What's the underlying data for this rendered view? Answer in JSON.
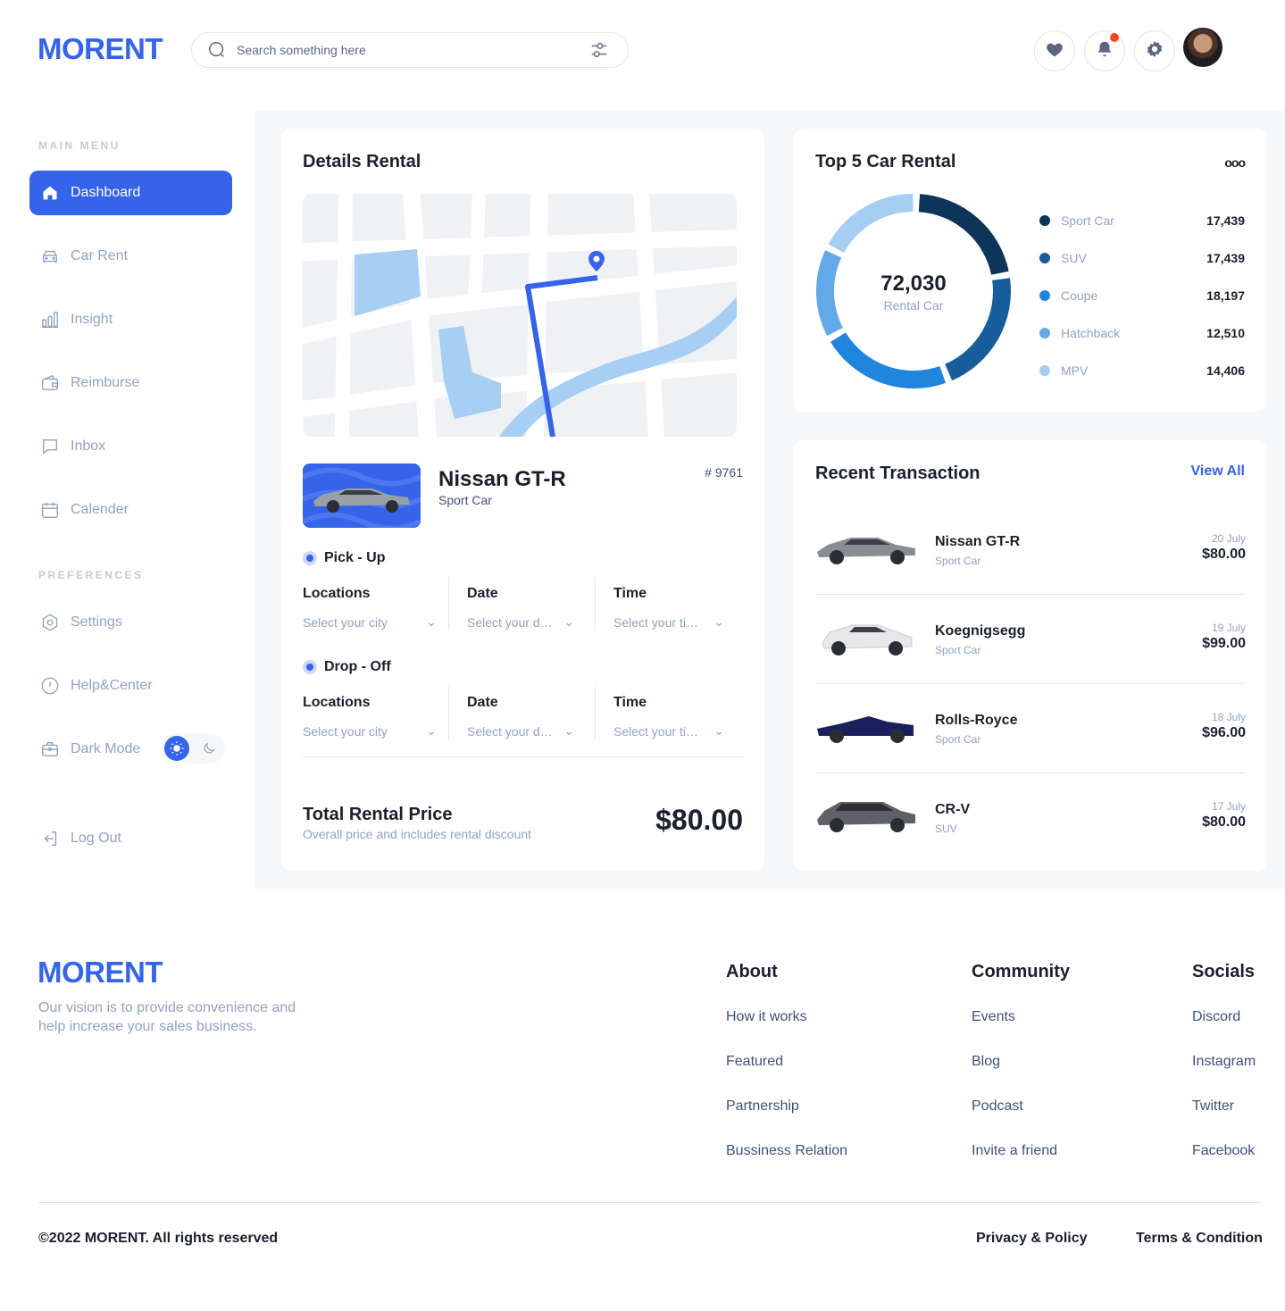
{
  "brand": {
    "name": "MORENT",
    "accent": "#3563e9"
  },
  "search": {
    "placeholder": "Search something here"
  },
  "sidebar": {
    "main_menu_heading": "MAIN MENU",
    "preferences_heading": "PREFERENCES",
    "items": [
      {
        "label": "Dashboard",
        "icon": "home-icon",
        "active": true
      },
      {
        "label": "Car Rent",
        "icon": "car-icon"
      },
      {
        "label": "Insight",
        "icon": "chart-icon"
      },
      {
        "label": "Reimburse",
        "icon": "wallet-icon"
      },
      {
        "label": "Inbox",
        "icon": "message-icon"
      },
      {
        "label": "Calender",
        "icon": "calendar-icon"
      }
    ],
    "preferences": [
      {
        "label": "Settings",
        "icon": "settings-icon"
      },
      {
        "label": "Help&Center",
        "icon": "info-icon"
      },
      {
        "label": "Dark Mode",
        "icon": "briefcase-icon"
      }
    ],
    "logout_label": "Log Out"
  },
  "details": {
    "title": "Details Rental",
    "car_name": "Nissan GT-R",
    "car_type": "Sport Car",
    "car_id": "# 9761",
    "pickup": {
      "heading": "Pick - Up",
      "location_label": "Locations",
      "location_value": "Select your city",
      "date_label": "Date",
      "date_value": "Select your date",
      "time_label": "Time",
      "time_value": "Select your time"
    },
    "dropoff": {
      "heading": "Drop - Off",
      "location_label": "Locations",
      "location_value": "Select your city",
      "date_label": "Date",
      "date_value": "Select your date",
      "time_label": "Time",
      "time_value": "Select your time"
    },
    "total_title": "Total Rental Price",
    "total_sub": "Overall price and includes rental discount",
    "total_price": "$80.00"
  },
  "top5": {
    "title": "Top 5 Car Rental",
    "more": "ooo",
    "total": "72,030",
    "total_label": "Rental Car",
    "items": [
      {
        "name": "Sport Car",
        "value": "17,439",
        "color": "#0d3559"
      },
      {
        "name": "SUV",
        "value": "17,439",
        "color": "#175d9c"
      },
      {
        "name": "Coupe",
        "value": "18,197",
        "color": "#2185de"
      },
      {
        "name": "Hatchback",
        "value": "12,510",
        "color": "#63a9e8"
      },
      {
        "name": "MPV",
        "value": "14,406",
        "color": "#a6cef2"
      }
    ]
  },
  "transactions": {
    "title": "Recent Transaction",
    "view_all": "View All",
    "rows": [
      {
        "name": "Nissan GT-R",
        "type": "Sport Car",
        "date": "20 July",
        "price": "$80.00",
        "color": "#8a8d93"
      },
      {
        "name": "Koegnigsegg",
        "type": "Sport Car",
        "date": "19 July",
        "price": "$99.00",
        "color": "#e8e8ea"
      },
      {
        "name": "Rolls-Royce",
        "type": "Sport Car",
        "date": "18 July",
        "price": "$96.00",
        "color": "#1c1f5e"
      },
      {
        "name": "CR-V",
        "type": "SUV",
        "date": "17 July",
        "price": "$80.00",
        "color": "#5f6166"
      }
    ]
  },
  "footer": {
    "logo": "MORENT",
    "vision": "Our vision is to provide convenience and help increase your sales business.",
    "columns": [
      {
        "heading": "About",
        "links": [
          "How it works",
          "Featured",
          "Partnership",
          "Bussiness Relation"
        ]
      },
      {
        "heading": "Community",
        "links": [
          "Events",
          "Blog",
          "Podcast",
          "Invite a friend"
        ]
      },
      {
        "heading": "Socials",
        "links": [
          "Discord",
          "Instagram",
          "Twitter",
          "Facebook"
        ]
      }
    ],
    "copyright": "©2022 MORENT. All rights reserved",
    "privacy": "Privacy & Policy",
    "terms": "Terms & Condition"
  }
}
